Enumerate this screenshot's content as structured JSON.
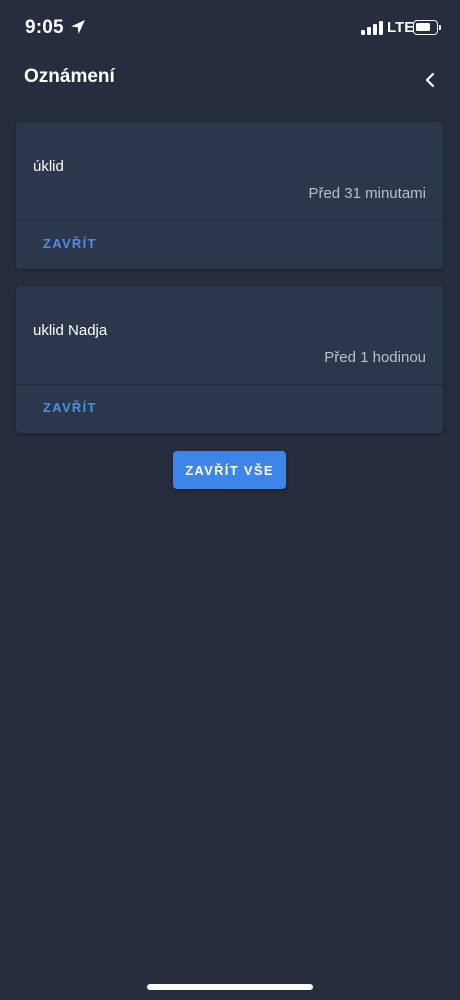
{
  "status_bar": {
    "time": "9:05",
    "network": "LTE",
    "icons": [
      "location-arrow-icon",
      "signal-icon",
      "battery-icon"
    ]
  },
  "header": {
    "title": "Oznámení",
    "back_icon": "chevron-left-icon"
  },
  "notifications": [
    {
      "title": "úklid",
      "time": "Před 31 minutami",
      "close_label": "ZAVŘÍT"
    },
    {
      "title": "uklid Nadja",
      "time": "Před 1 hodinou",
      "close_label": "ZAVŘÍT"
    }
  ],
  "actions": {
    "close_all_label": "ZAVŘÍT VŠE"
  },
  "colors": {
    "background": "#262d3f",
    "card": "#2d374b",
    "accent": "#3e85ea",
    "link": "#4a8fef",
    "muted_text": "#b9bfcc"
  }
}
